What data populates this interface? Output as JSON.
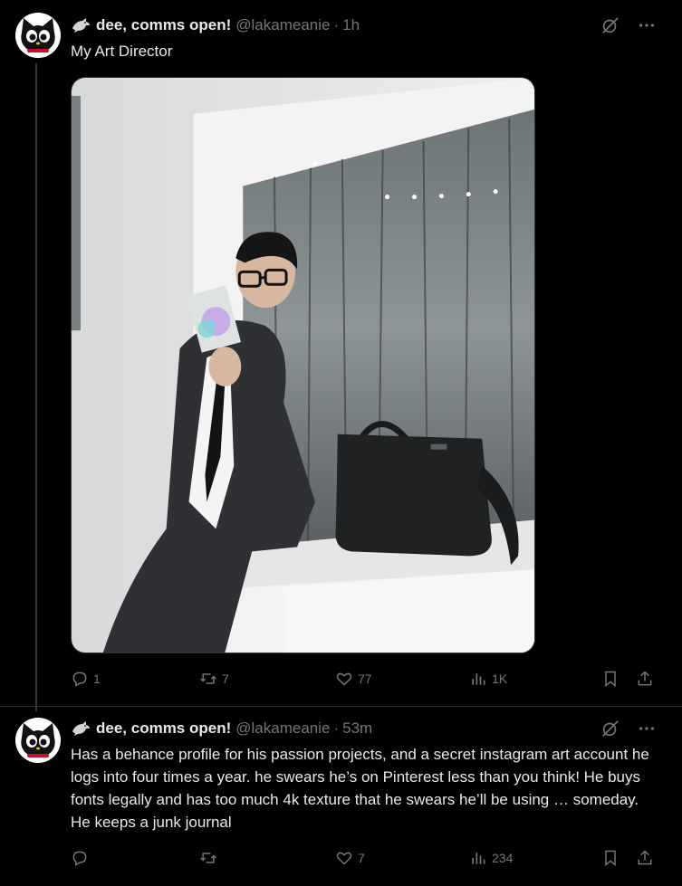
{
  "tweets": [
    {
      "display_name": "dee, comms open!",
      "handle": "@lakameanie",
      "separator": "·",
      "time": "1h",
      "text": "My Art Director",
      "replies": "1",
      "reposts": "7",
      "likes": "77",
      "views": "1K"
    },
    {
      "display_name": "dee, comms open!",
      "handle": "@lakameanie",
      "separator": "·",
      "time": "53m",
      "text": "Has a behance profile for his passion projects, and a secret instagram art account he logs into four times a year.  he swears he’s on Pinterest less than you think! He buys fonts legally and has too much 4k texture that he swears he’ll be using … someday. He keeps a junk journal",
      "replies": "",
      "reposts": "",
      "likes": "7",
      "views": "234"
    }
  ],
  "icons": {
    "name_badge": "bird-icon",
    "grok": "grok-icon",
    "more": "more-icon",
    "reply": "reply-icon",
    "repost": "repost-icon",
    "like": "like-icon",
    "views": "views-icon",
    "bookmark": "bookmark-icon",
    "share": "share-icon"
  },
  "colors": {
    "background": "#000000",
    "text": "#e7e9ea",
    "muted": "#71767b",
    "divider": "#2f3336"
  }
}
